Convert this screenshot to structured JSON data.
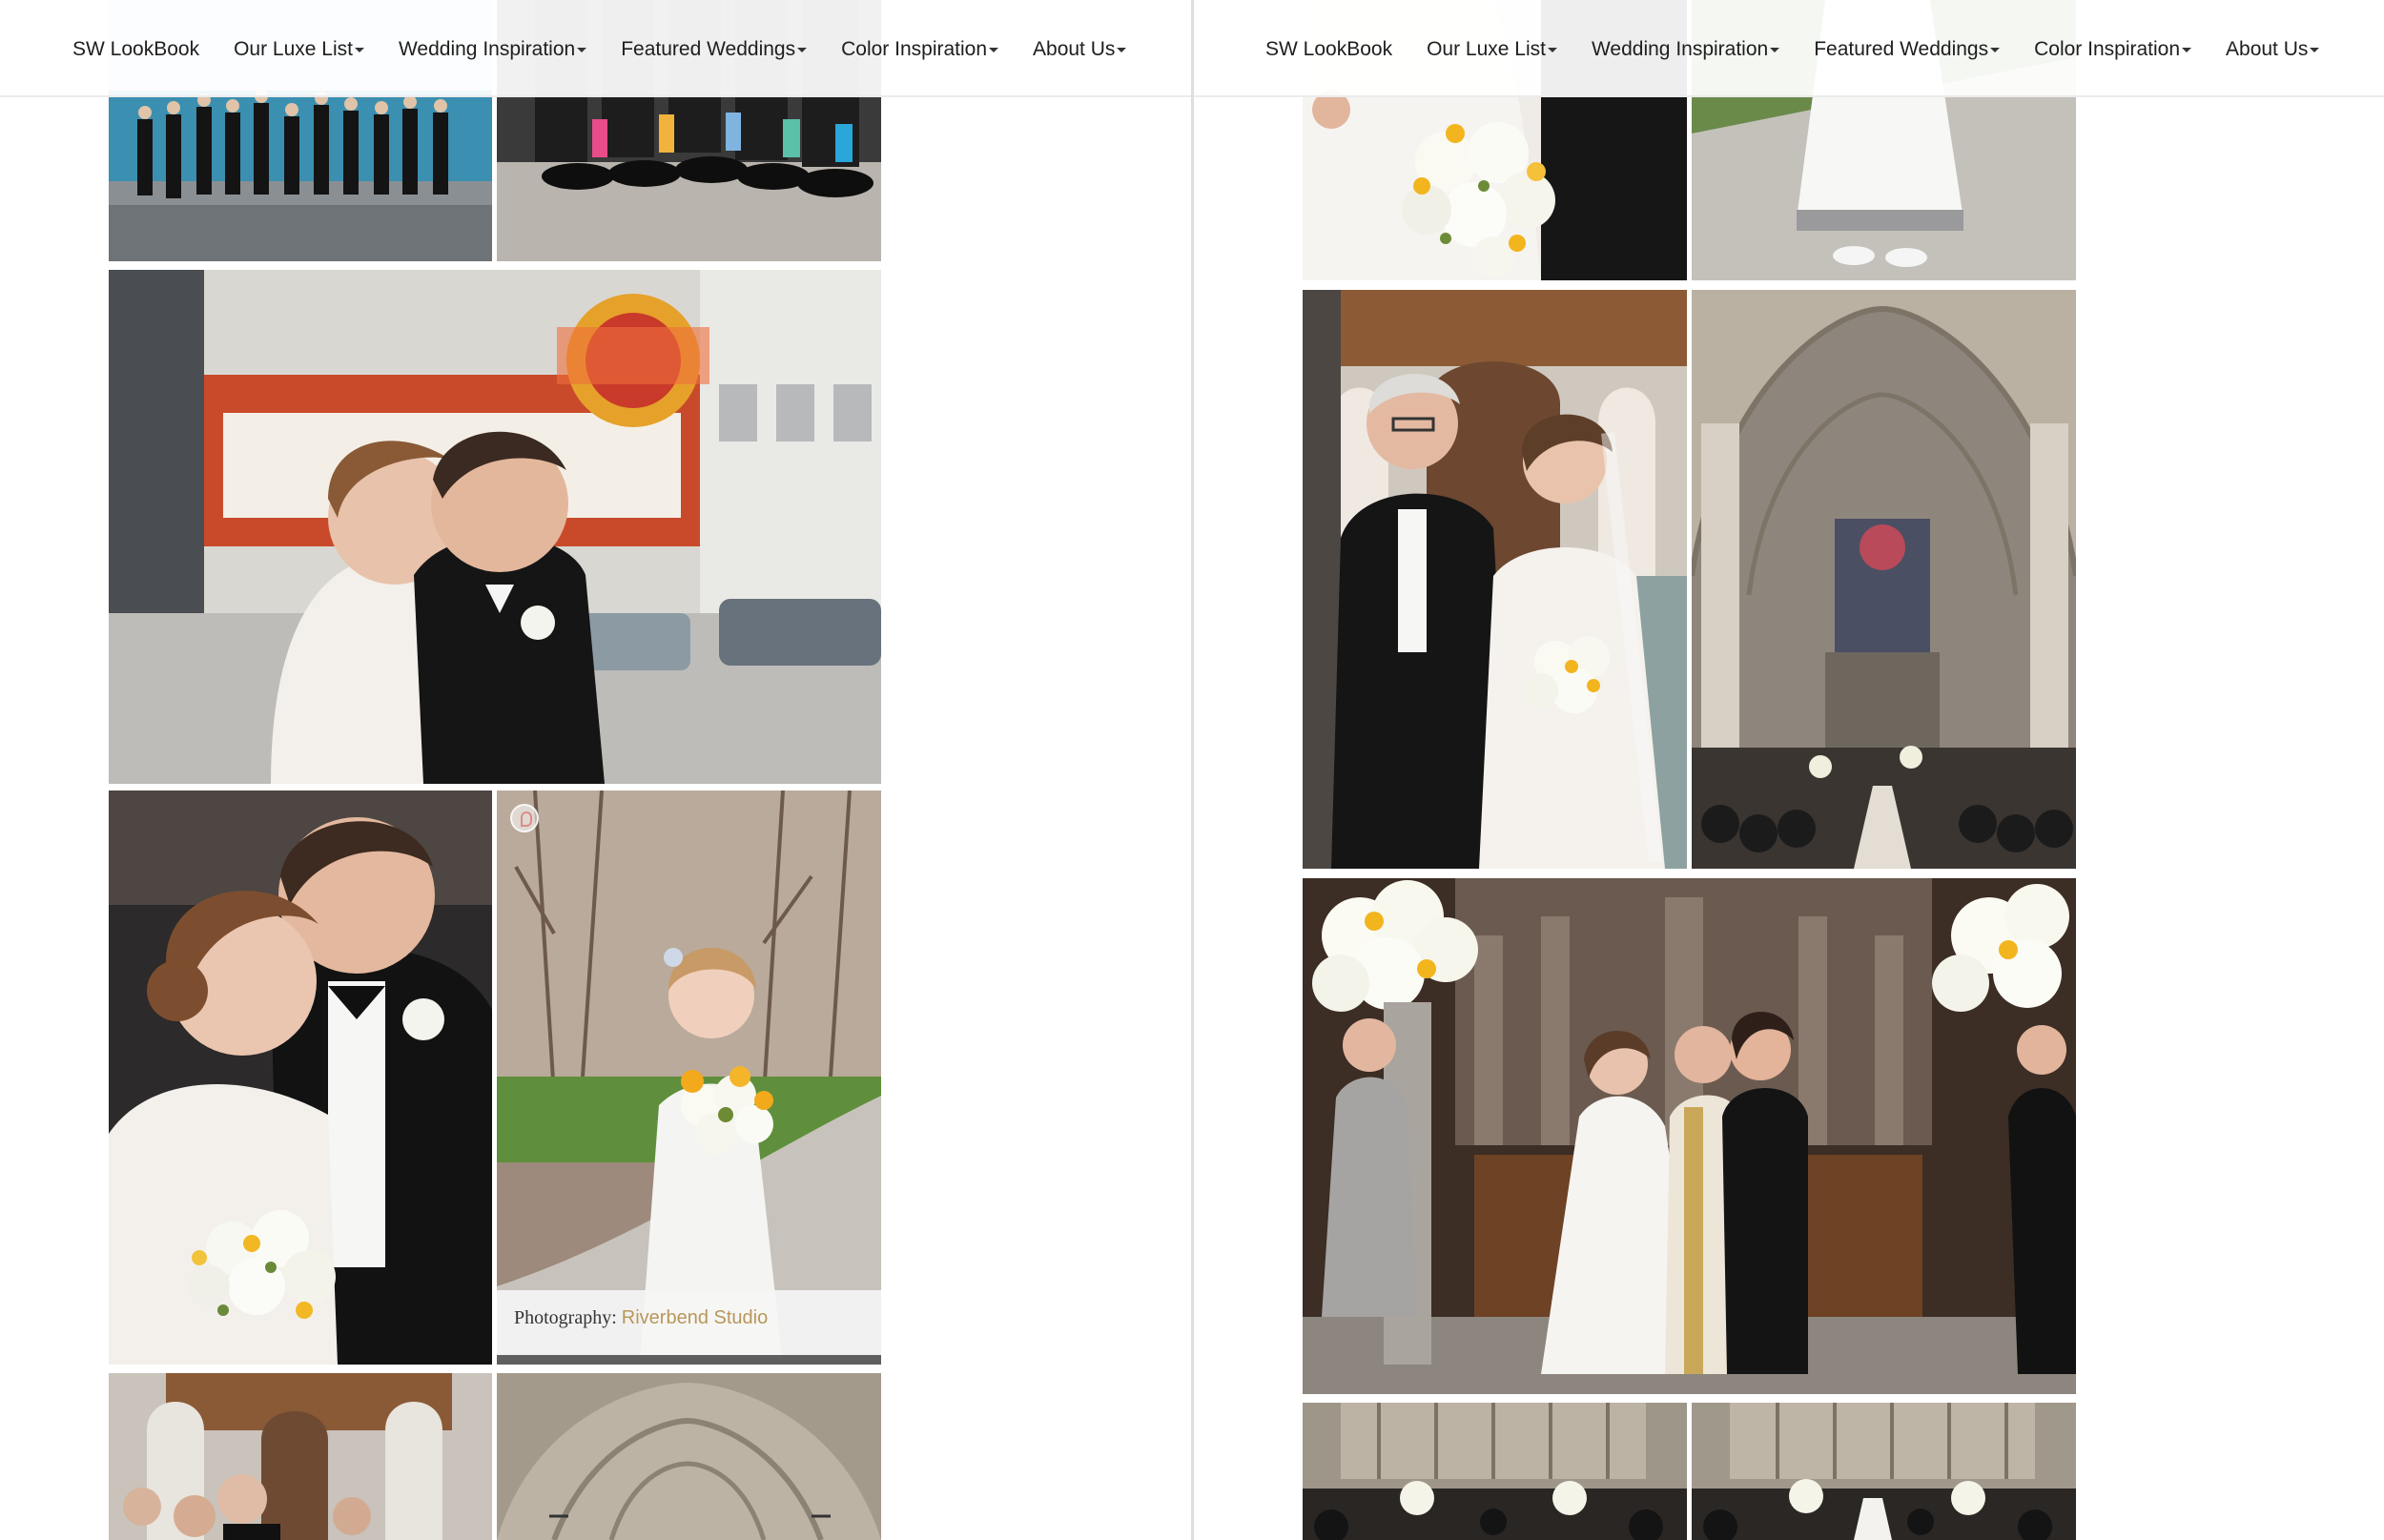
{
  "nav": {
    "items": [
      {
        "label": "SW LookBook",
        "dropdown": false
      },
      {
        "label": "Our Luxe List",
        "dropdown": true
      },
      {
        "label": "Wedding Inspiration",
        "dropdown": true
      },
      {
        "label": "Featured Weddings",
        "dropdown": true
      },
      {
        "label": "Color Inspiration",
        "dropdown": true
      },
      {
        "label": "About Us",
        "dropdown": true
      }
    ]
  },
  "credit": {
    "prefix": "Photography:",
    "studio": "Riverbend Studio"
  },
  "photos": {
    "left": [
      "groomsmen-jumping-lakefront",
      "groomsmen-colorful-socks",
      "couple-chicago-theatre-marquee",
      "couple-portrait-bouquet",
      "flower-girl-yellow-bouquet",
      "father-escorting-bride",
      "chapel-interior-arches"
    ],
    "right": [
      "bride-bouquet-closeup",
      "flower-girl-dress-detail",
      "father-walking-bride-aisle",
      "cathedral-nave-ceremony",
      "altar-vows-officiant",
      "chapel-guests-aisle-left",
      "chapel-guests-aisle-right"
    ]
  },
  "colors": {
    "accent": "#b8975a",
    "nav_text": "#1e1e1e",
    "divider": "#dedede"
  }
}
